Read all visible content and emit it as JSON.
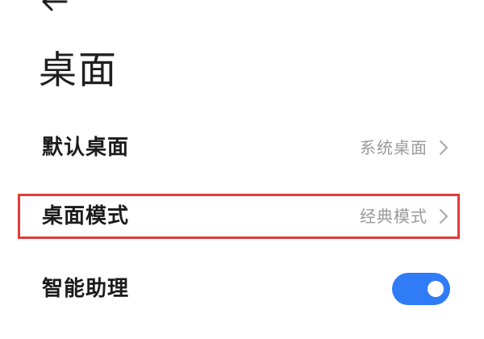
{
  "page": {
    "title": "桌面"
  },
  "settings": {
    "items": [
      {
        "label": "默认桌面",
        "value": "系统桌面",
        "icon": "chevron-right-icon"
      },
      {
        "label": "桌面模式",
        "value": "经典模式",
        "icon": "chevron-right-icon",
        "highlighted": true
      },
      {
        "label": "智能助理",
        "toggle": true
      }
    ]
  },
  "colors": {
    "accent": "#2f7cf6",
    "highlight_border": "#e53a3a",
    "value_text": "#9a9a9a",
    "label_text": "#1b1b1b"
  },
  "icons": {
    "back": "back-arrow-icon"
  }
}
